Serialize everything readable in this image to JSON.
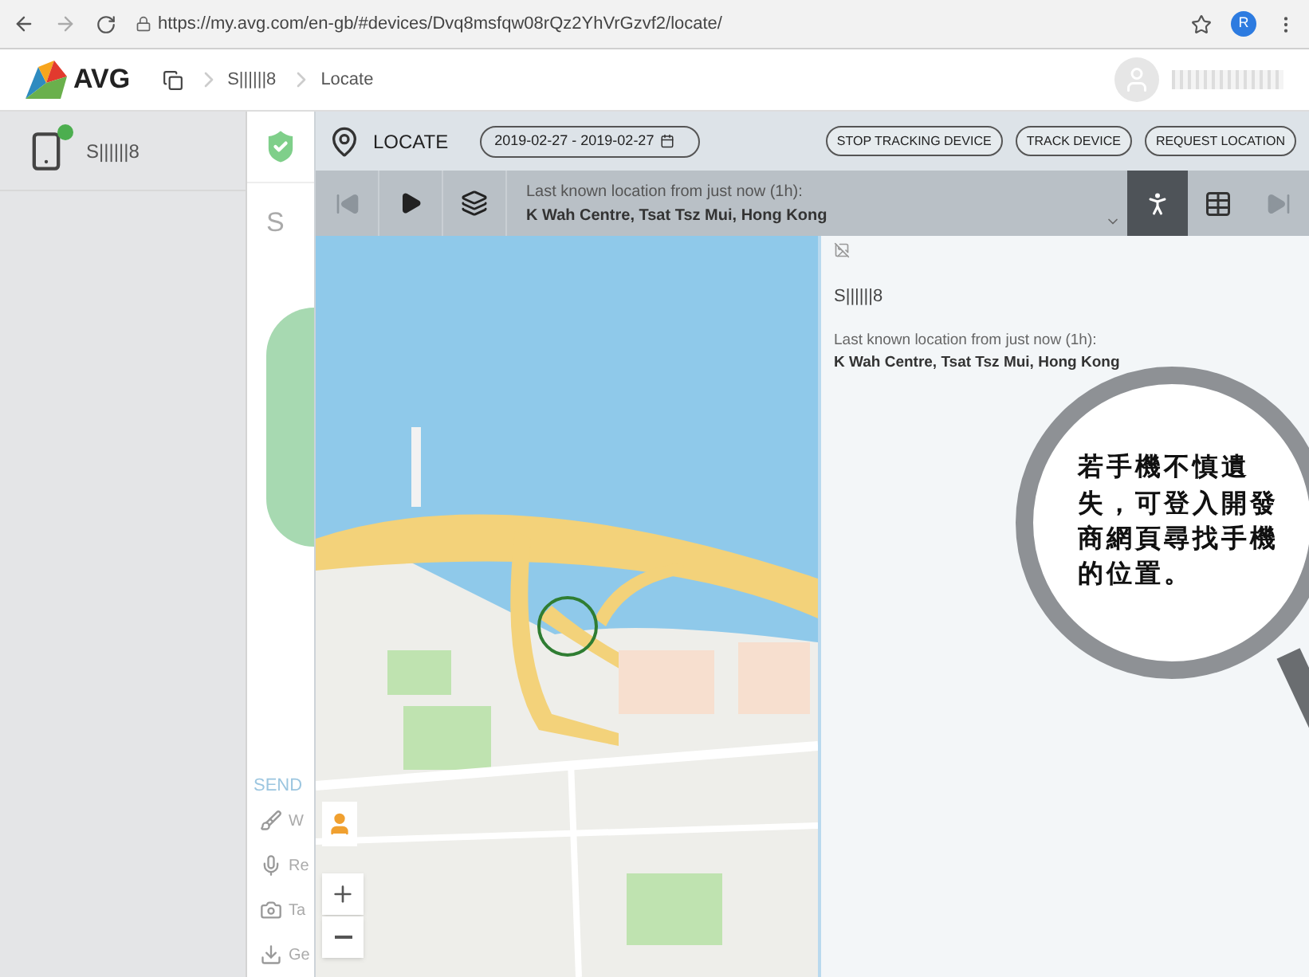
{
  "browser": {
    "url": "https://my.avg.com/en-gb/#devices/Dvq8msfqw08rQz2YhVrGzvf2/locate/",
    "profile_initial": "R"
  },
  "header": {
    "logo": "AVG",
    "breadcrumbs": [
      "S||||||8",
      "Locate"
    ]
  },
  "sidebar": {
    "devices": [
      {
        "name": "S||||||8"
      }
    ]
  },
  "device_panel": {
    "title": "S",
    "send_heading": "SEND",
    "actions": [
      {
        "kind": "wipe",
        "label": "W"
      },
      {
        "kind": "record",
        "label": "Re"
      },
      {
        "kind": "photo",
        "label": "Ta"
      },
      {
        "kind": "get",
        "label": "Ge"
      }
    ]
  },
  "locate": {
    "title": "LOCATE",
    "date_range": "2019-02-27 - 2019-02-27",
    "buttons": [
      "STOP TRACKING DEVICE",
      "TRACK DEVICE",
      "REQUEST LOCATION"
    ],
    "location_label": "Last known location from just now (1h):",
    "location": "K Wah Centre, Tsat Tsz Mui, Hong Kong",
    "views": [
      {
        "kind": "person",
        "selected": true
      },
      {
        "kind": "table",
        "selected": false
      }
    ]
  },
  "info": {
    "device_name": "S||||||8",
    "location_label": "Last known location from just now (1h):",
    "location": "K Wah Centre, Tsat Tsz Mui, Hong Kong"
  },
  "callout": {
    "lines": [
      "若手機不慎遺",
      "失，可登入開發",
      "商網頁尋找手機",
      "的位置。"
    ]
  }
}
